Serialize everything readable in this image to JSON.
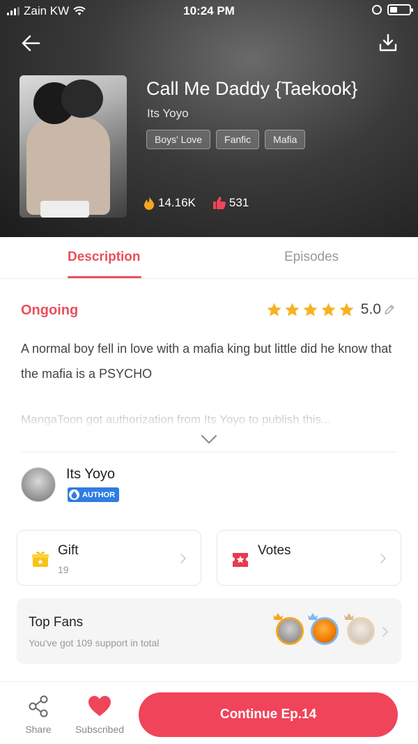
{
  "status_bar": {
    "carrier": "Zain KW",
    "time": "10:24 PM"
  },
  "comic": {
    "title": "Call Me Daddy {Taekook}",
    "author": "Its Yoyo",
    "tags": [
      "Boys' Love",
      "Fanfic",
      "Mafia"
    ],
    "views": "14.16K",
    "likes": "531"
  },
  "tabs": {
    "description": "Description",
    "episodes": "Episodes",
    "active": "description"
  },
  "details": {
    "status": "Ongoing",
    "rating": "5.0",
    "stars": 5,
    "description": "A normal boy fell in love with a mafia king but little did he know that the mafia is a PSYCHO",
    "authorization_note": "MangaToon got authorization from Its Yoyo to publish this..."
  },
  "author_section": {
    "name": "Its Yoyo",
    "badge": "AUTHOR"
  },
  "cards": {
    "gift": {
      "title": "Gift",
      "count": "19"
    },
    "votes": {
      "title": "Votes"
    }
  },
  "top_fans": {
    "title": "Top Fans",
    "subtitle": "You've got 109 support in total"
  },
  "bottom_bar": {
    "share": "Share",
    "subscribed": "Subscribed",
    "continue": "Continue Ep.14"
  },
  "colors": {
    "accent": "#e8505b",
    "button": "#f0445a",
    "star": "#f5b324",
    "badge": "#2f7de1"
  }
}
